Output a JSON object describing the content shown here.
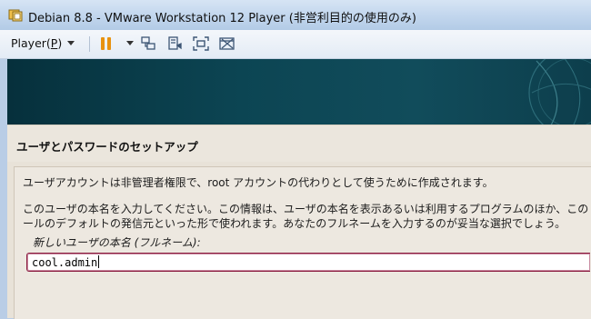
{
  "window": {
    "title": "Debian 8.8 - VMware Workstation 12 Player (非営利目的の使用のみ)",
    "icon": "vmware-player-icon"
  },
  "toolbar": {
    "player_menu_prefix": "Player(",
    "player_menu_key": "P",
    "player_menu_suffix": ")",
    "icons": [
      "pause-icon",
      "send-ctrl-alt-del-icon",
      "removable-devices-icon",
      "fullscreen-icon",
      "unity-icon"
    ]
  },
  "installer": {
    "section_title": "ユーザとパスワードのセットアップ",
    "line1": "ユーザアカウントは非管理者権限で、root アカウントの代わりとして使うために作成されます。",
    "line2": "このユーザの本名を入力してください。この情報は、ユーザの本名を表示あるいは利用するプログラムのほか、この",
    "line3": "ールのデフォルトの発信元といった形で使われます。あなたのフルネームを入力するのが妥当な選択でしょう。",
    "field_label": "新しいユーザの本名 (フルネーム):",
    "field_value": "cool.admin"
  },
  "colors": {
    "banner": "#0c4553",
    "input_border": "#8a1b3f",
    "pause_icon": "#e8920f"
  }
}
